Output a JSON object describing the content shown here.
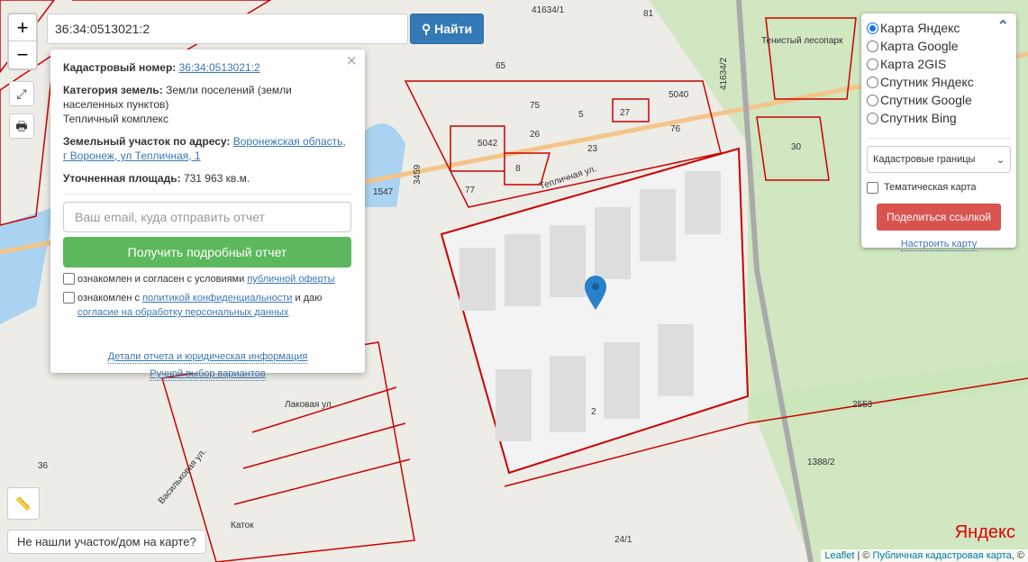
{
  "search": {
    "value": "36:34:0513021:2",
    "button": "Найти"
  },
  "zoom": {
    "in": "+",
    "out": "−"
  },
  "popup": {
    "cad_label": "Кадастровый номер:",
    "cad_value": "36:34:0513021:2",
    "cat_label": "Категория земель:",
    "cat_value": "Земли поселений (земли населенных пунктов)",
    "usage": "Тепличный комплекс",
    "addr_label": "Земельный участок по адресу:",
    "addr_value": "Воронежская область, г Воронеж, ул Тепличная, 1",
    "area_label": "Уточненная площадь:",
    "area_value": "731 963 кв.м.",
    "email_placeholder": "Ваш email, куда отправить отчет",
    "report_button": "Получить подробный отчет",
    "check1_text": "ознакомлен и согласен с условиями ",
    "check1_link": "публичной оферты",
    "check2_text": "ознакомлен с ",
    "check2_link": "политикой конфиденциальности",
    "check2_mid": " и даю ",
    "check2_link2": "согласие на обработку персональных данных",
    "details_link": "Детали отчета и юридическая информация",
    "manual_link": "Ручной выбор вариантов",
    "close": "×"
  },
  "layers": {
    "options": [
      {
        "label": "Карта Яндекс",
        "selected": true
      },
      {
        "label": "Карта Google",
        "selected": false
      },
      {
        "label": "Карта 2GIS",
        "selected": false
      },
      {
        "label": "Спутник Яндекс",
        "selected": false
      },
      {
        "label": "Спутник Google",
        "selected": false
      },
      {
        "label": "Спутник Bing",
        "selected": false
      }
    ],
    "overlay_select": "Кадастровые границы",
    "thematic": "Тематическая карта",
    "share": "Поделиться ссылкой",
    "configure": "Настроить карту"
  },
  "not_found": "Не нашли участок/дом на карте?",
  "attribution": {
    "leaflet": "Leaflet",
    "sep": " | © ",
    "pkk": "Публичная кадастровая карта",
    "tail": ", ©"
  },
  "yandex_logo": "Яндекс",
  "map_labels": {
    "l1": "Тепличная ул.",
    "l2": "2",
    "l3": "5040",
    "l4": "5042",
    "l5": "27",
    "l6": "23",
    "l7": "26",
    "l8": "8",
    "l9": "30",
    "l10": "2553",
    "l11": "1388/2",
    "l12": "24/1",
    "l13": "36",
    "l14": "1547",
    "l15": "3459",
    "l16": "41634/1",
    "l17": "41634/2",
    "l18": "Тенистый лесопарк",
    "l19": "Каток",
    "l20": "Васильковая ул.",
    "l21": "Лаковая ул.",
    "l22": "77",
    "l23": "65",
    "l24": "75",
    "l25": "5",
    "l26": "76",
    "l27": "81"
  },
  "colors": {
    "parcel": "#cc0000",
    "selected_fill": "#f3f3f3",
    "green": "#c8e6b8",
    "pin": "#2a81cb"
  }
}
